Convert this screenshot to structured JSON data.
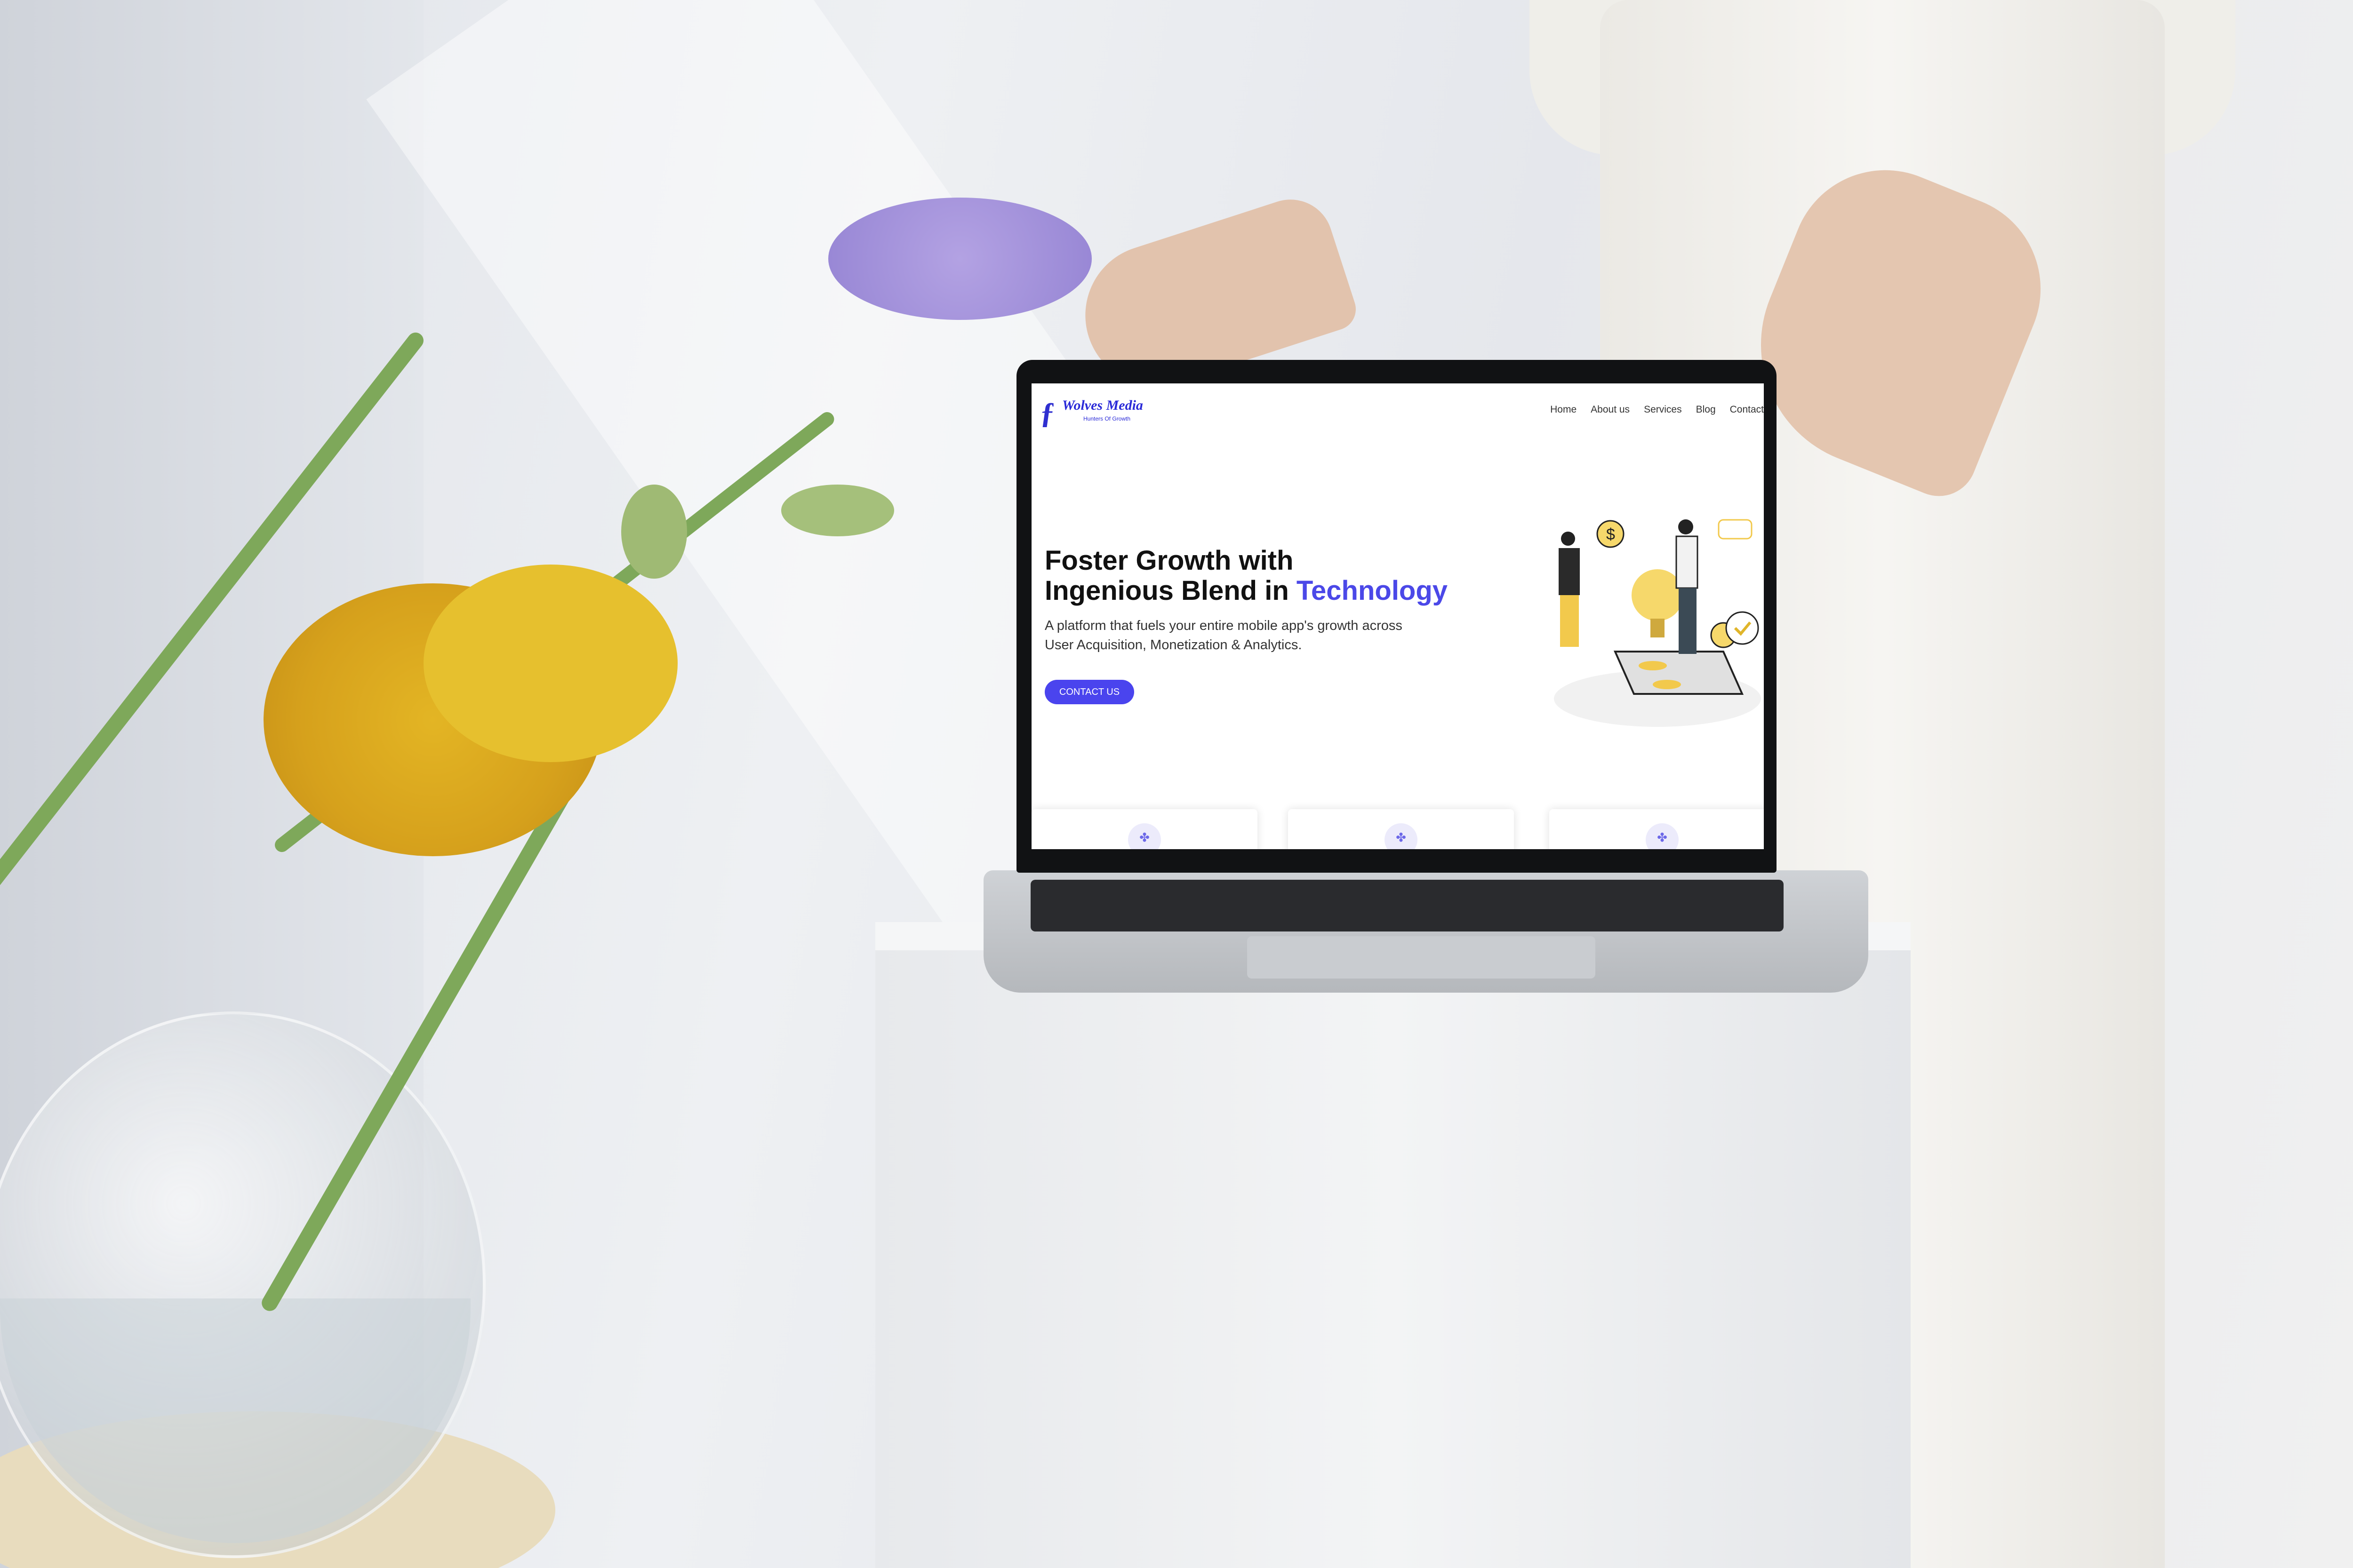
{
  "site": {
    "logo": {
      "mark": "ƒ",
      "name": "Wolves Media",
      "tagline": "Hunters Of Growth"
    },
    "nav": [
      "Home",
      "About us",
      "Services",
      "Blog",
      "Contact"
    ],
    "hero": {
      "title_line1": "Foster Growth with",
      "title_line2_prefix": "Ingenious Blend in ",
      "title_line2_accent": "Technology",
      "subtitle_line1": "A platform that fuels your entire mobile app's growth across",
      "subtitle_line2": "User Acquisition, Monetization & Analytics.",
      "cta_label": "CONTACT US"
    },
    "cards": [
      {
        "icon": "growth-icon"
      },
      {
        "icon": "growth-icon"
      },
      {
        "icon": "growth-icon"
      }
    ]
  },
  "colors": {
    "accent": "#4b48e8",
    "button": "#4a44ee",
    "logo": "#2a2ad8"
  }
}
